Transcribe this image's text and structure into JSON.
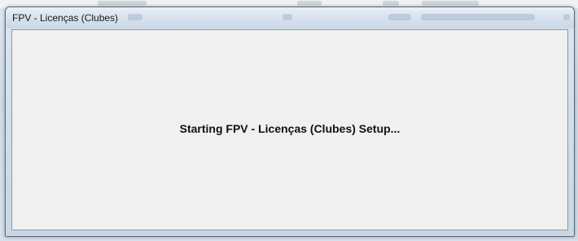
{
  "window": {
    "title": "FPV - Licenças (Clubes)"
  },
  "main": {
    "status_text": "Starting FPV - Licenças (Clubes) Setup..."
  }
}
